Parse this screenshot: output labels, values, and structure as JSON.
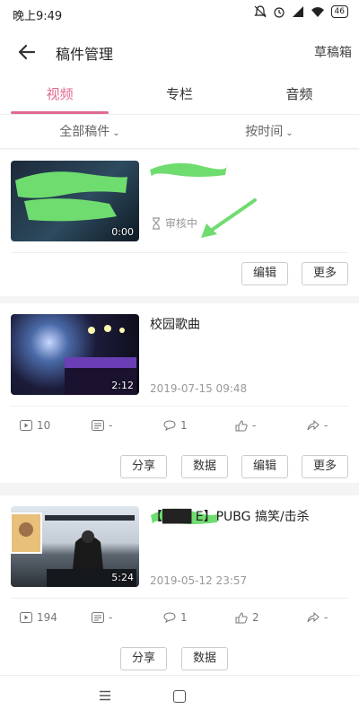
{
  "status_bar": {
    "time": "晚上9:49",
    "battery": "46"
  },
  "header": {
    "title": "稿件管理",
    "drafts_label": "草稿箱"
  },
  "tabs": [
    {
      "label": "视频"
    },
    {
      "label": "专栏"
    },
    {
      "label": "音频"
    }
  ],
  "filters": {
    "all": "全部稿件",
    "sort": "按时间"
  },
  "videos": [
    {
      "title": "",
      "duration": "0:00",
      "status": "审核中",
      "actions": [
        "编辑",
        "更多"
      ]
    },
    {
      "title": "校园歌曲",
      "duration": "2:12",
      "date": "2019-07-15 09:48",
      "stats": {
        "plays": "10",
        "danmaku": "-",
        "comments": "1",
        "likes": "-",
        "shares": "-"
      },
      "actions": [
        "分享",
        "数据",
        "编辑",
        "更多"
      ]
    },
    {
      "title": "【███ E】PUBG 搞笑/击杀",
      "duration": "5:24",
      "date": "2019-05-12 23:57",
      "stats": {
        "plays": "194",
        "danmaku": "-",
        "comments": "1",
        "likes": "2",
        "shares": "-"
      },
      "actions": [
        "分享",
        "数据"
      ]
    }
  ],
  "colors": {
    "accent": "#e06a8f",
    "annotation_green": "#6fdc6f"
  }
}
